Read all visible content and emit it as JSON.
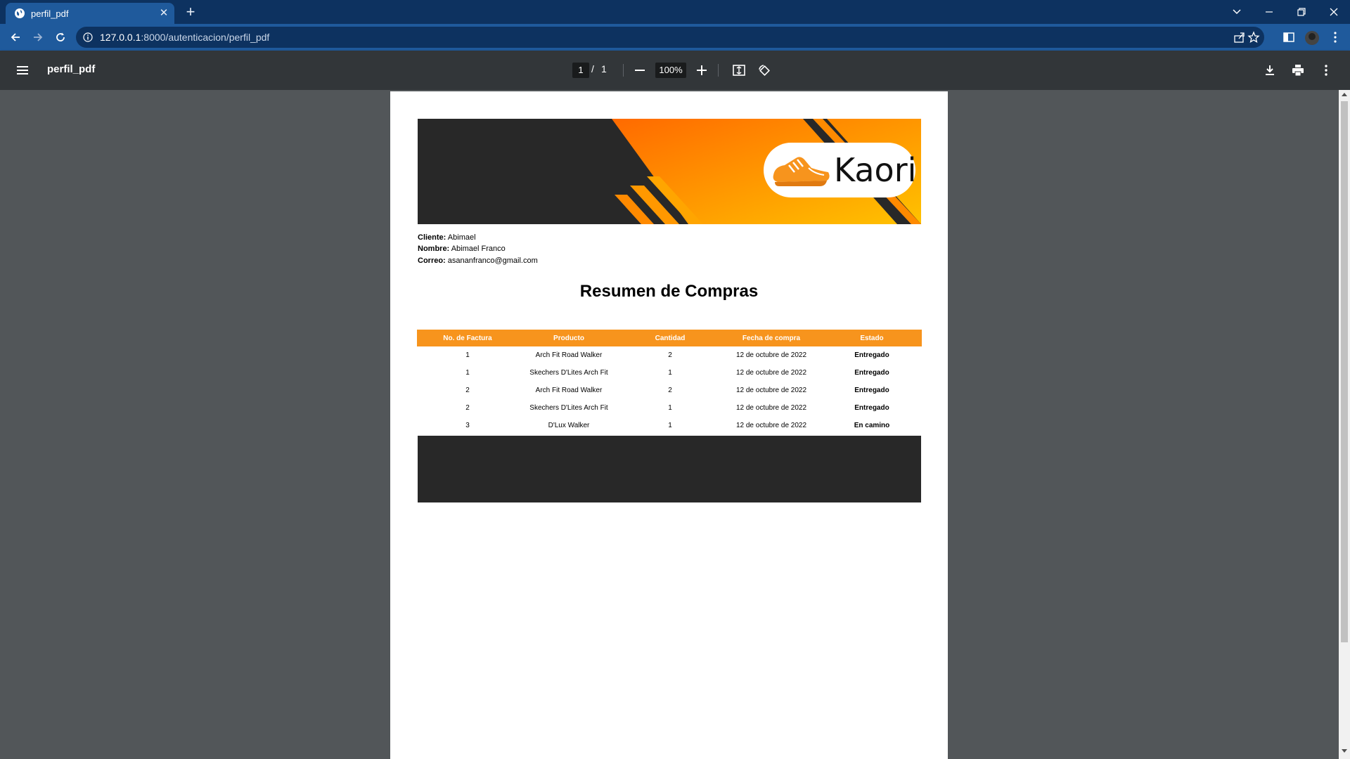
{
  "browser": {
    "tab_title": "perfil_pdf",
    "url_host": "127.0.0.1",
    "url_rest": ":8000/autenticacion/perfil_pdf"
  },
  "pdf_viewer": {
    "title": "perfil_pdf",
    "current_page": "1",
    "page_separator": "/",
    "total_pages": "1",
    "zoom": "100%"
  },
  "document": {
    "logo_text": "Kaori",
    "client_label": "Cliente:",
    "client_value": "Abimael",
    "name_label": "Nombre:",
    "name_value": "Abimael Franco",
    "email_label": "Correo:",
    "email_value": "asananfranco@gmail.com",
    "heading": "Resumen de Compras",
    "table": {
      "headers": [
        "No. de Factura",
        "Producto",
        "Cantidad",
        "Fecha de compra",
        "Estado"
      ],
      "rows": [
        [
          "1",
          "Arch Fit Road Walker",
          "2",
          "12 de octubre de 2022",
          "Entregado"
        ],
        [
          "1",
          "Skechers D'Lites Arch Fit",
          "1",
          "12 de octubre de 2022",
          "Entregado"
        ],
        [
          "2",
          "Arch Fit Road Walker",
          "2",
          "12 de octubre de 2022",
          "Entregado"
        ],
        [
          "2",
          "Skechers D'Lites Arch Fit",
          "1",
          "12 de octubre de 2022",
          "Entregado"
        ],
        [
          "3",
          "D'Lux Walker",
          "1",
          "12 de octubre de 2022",
          "En camino"
        ]
      ]
    }
  },
  "colors": {
    "accent_orange": "#f7941d",
    "banner_dark": "#282828",
    "chrome_blue": "#1f5a9c"
  }
}
